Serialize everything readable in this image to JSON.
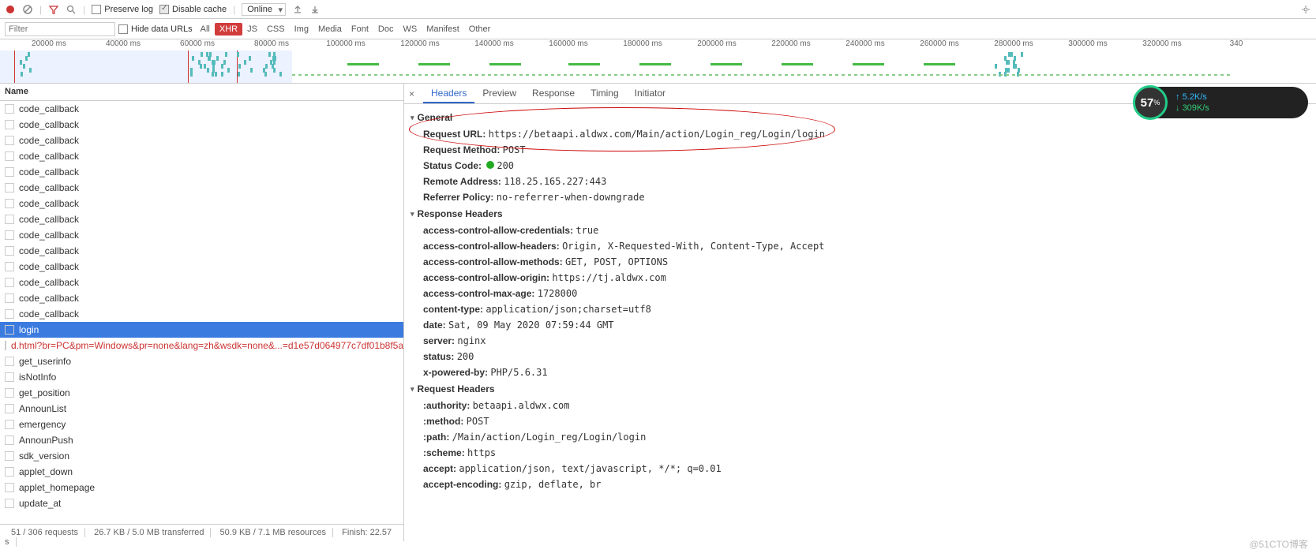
{
  "toolbar": {
    "preserve_log": "Preserve log",
    "disable_cache": "Disable cache",
    "throttle": "Online"
  },
  "filterbar": {
    "filter_placeholder": "Filter",
    "hide_data_urls": "Hide data URLs",
    "types": [
      "All",
      "XHR",
      "JS",
      "CSS",
      "Img",
      "Media",
      "Font",
      "Doc",
      "WS",
      "Manifest",
      "Other"
    ],
    "active_type": "XHR"
  },
  "timeline": {
    "ticks": [
      "20000 ms",
      "40000 ms",
      "60000 ms",
      "80000 ms",
      "100000 ms",
      "120000 ms",
      "140000 ms",
      "160000 ms",
      "180000 ms",
      "200000 ms",
      "220000 ms",
      "240000 ms",
      "260000 ms",
      "280000 ms",
      "300000 ms",
      "320000 ms",
      "340"
    ]
  },
  "network": {
    "name_header": "Name",
    "requests": [
      {
        "name": "code_callback"
      },
      {
        "name": "code_callback"
      },
      {
        "name": "code_callback"
      },
      {
        "name": "code_callback"
      },
      {
        "name": "code_callback"
      },
      {
        "name": "code_callback"
      },
      {
        "name": "code_callback"
      },
      {
        "name": "code_callback"
      },
      {
        "name": "code_callback"
      },
      {
        "name": "code_callback"
      },
      {
        "name": "code_callback"
      },
      {
        "name": "code_callback"
      },
      {
        "name": "code_callback"
      },
      {
        "name": "code_callback"
      },
      {
        "name": "login",
        "selected": true
      },
      {
        "name": "d.html?br=PC&pm=Windows&pr=none&lang=zh&wsdk=none&...=d1e57d064977c7df01b8f5a",
        "red": true
      },
      {
        "name": "get_userinfo"
      },
      {
        "name": "isNotInfo"
      },
      {
        "name": "get_position"
      },
      {
        "name": "AnnounList"
      },
      {
        "name": "emergency"
      },
      {
        "name": "AnnounPush"
      },
      {
        "name": "sdk_version"
      },
      {
        "name": "applet_down"
      },
      {
        "name": "applet_homepage"
      },
      {
        "name": "update_at"
      }
    ],
    "status": {
      "reqs": "51 / 306 requests",
      "transferred": "26.7 KB / 5.0 MB transferred",
      "resources": "50.9 KB / 7.1 MB resources",
      "finish": "Finish: 22.57 s"
    }
  },
  "detail": {
    "tabs": [
      "Headers",
      "Preview",
      "Response",
      "Timing",
      "Initiator"
    ],
    "active_tab": "Headers",
    "sections": {
      "general": "General",
      "response_headers": "Response Headers",
      "request_headers": "Request Headers"
    },
    "general": [
      {
        "k": "Request URL:",
        "v": "https://betaapi.aldwx.com/Main/action/Login_reg/Login/login"
      },
      {
        "k": "Request Method:",
        "v": "POST"
      },
      {
        "k": "Status Code:",
        "v": "200",
        "status": true
      },
      {
        "k": "Remote Address:",
        "v": "118.25.165.227:443"
      },
      {
        "k": "Referrer Policy:",
        "v": "no-referrer-when-downgrade"
      }
    ],
    "response_headers": [
      {
        "k": "access-control-allow-credentials:",
        "v": "true"
      },
      {
        "k": "access-control-allow-headers:",
        "v": "Origin, X-Requested-With, Content-Type, Accept"
      },
      {
        "k": "access-control-allow-methods:",
        "v": "GET, POST, OPTIONS"
      },
      {
        "k": "access-control-allow-origin:",
        "v": "https://tj.aldwx.com"
      },
      {
        "k": "access-control-max-age:",
        "v": "1728000"
      },
      {
        "k": "content-type:",
        "v": "application/json;charset=utf8"
      },
      {
        "k": "date:",
        "v": "Sat, 09 May 2020 07:59:44 GMT"
      },
      {
        "k": "server:",
        "v": "nginx"
      },
      {
        "k": "status:",
        "v": "200"
      },
      {
        "k": "x-powered-by:",
        "v": "PHP/5.6.31"
      }
    ],
    "request_headers": [
      {
        "k": ":authority:",
        "v": "betaapi.aldwx.com"
      },
      {
        "k": ":method:",
        "v": "POST"
      },
      {
        "k": ":path:",
        "v": "/Main/action/Login_reg/Login/login"
      },
      {
        "k": ":scheme:",
        "v": "https"
      },
      {
        "k": "accept:",
        "v": "application/json, text/javascript, */*; q=0.01"
      },
      {
        "k": "accept-encoding:",
        "v": "gzip, deflate, br"
      }
    ]
  },
  "meter": {
    "percent": "57",
    "percent_suffix": "%",
    "up": "5.2K/s",
    "down": "309K/s"
  },
  "watermark": "@51CTO博客"
}
